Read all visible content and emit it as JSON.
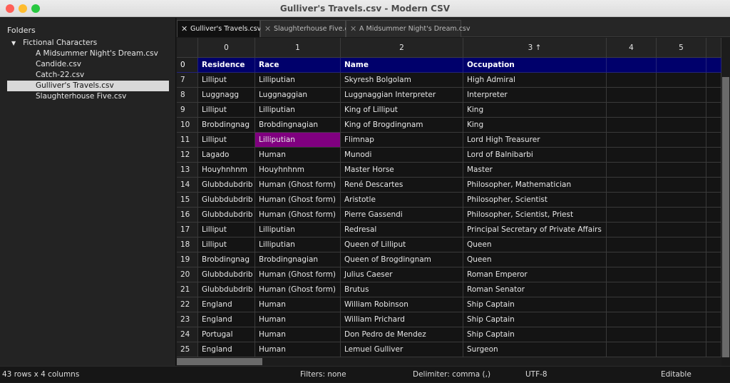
{
  "window": {
    "title": "Gulliver's Travels.csv - Modern CSV",
    "controls": {
      "close": "#ff5f57",
      "minimize": "#febc2e",
      "zoom": "#28c840"
    }
  },
  "sidebar": {
    "header": "Folders",
    "folder": "Fictional Characters",
    "files": [
      "A Midsummer Night's Dream.csv",
      "Candide.csv",
      "Catch-22.csv",
      "Gulliver's Travels.csv",
      "Slaughterhouse Five.csv"
    ],
    "selected_index": 3
  },
  "tabs": [
    {
      "label": "Gulliver's Travels.csv",
      "active": true
    },
    {
      "label": "Slaughterhouse Five.csv"
    },
    {
      "label": "A Midsummer Night's Dream.csv"
    }
  ],
  "grid": {
    "column_headers": [
      "0",
      "1",
      "2",
      "3 ↑",
      "4",
      "5",
      ""
    ],
    "header_row": {
      "num": "0",
      "cells": [
        "Residence",
        "Race",
        "Name",
        "Occupation"
      ]
    },
    "highlight_color": "#800080",
    "header_color": "#00006b",
    "rows": [
      {
        "num": "7",
        "cells": [
          "Lilliput",
          "Lilliputian",
          "Skyresh Bolgolam",
          "High Admiral"
        ]
      },
      {
        "num": "8",
        "cells": [
          "Luggnagg",
          "Luggnaggian",
          "Luggnaggian Interpreter",
          "Interpreter"
        ]
      },
      {
        "num": "9",
        "cells": [
          "Lilliput",
          "Lilliputian",
          "King of Lilliput",
          "King"
        ]
      },
      {
        "num": "10",
        "cells": [
          "Brobdingnag",
          "Brobdingnagian",
          "King of Brogdingnam",
          "King"
        ]
      },
      {
        "num": "11",
        "cells": [
          "Lilliput",
          "Lilliputian",
          "Flimnap",
          "Lord High Treasurer"
        ],
        "selected_col": 1
      },
      {
        "num": "12",
        "cells": [
          "Lagado",
          "Human",
          "Munodi",
          "Lord of Balnibarbi"
        ]
      },
      {
        "num": "13",
        "cells": [
          "Houyhnhnm",
          "Houyhnhnm",
          "Master Horse",
          "Master"
        ]
      },
      {
        "num": "14",
        "cells": [
          "Glubbdubdrib",
          "Human (Ghost form)",
          "René Descartes",
          "Philosopher, Mathematician"
        ]
      },
      {
        "num": "15",
        "cells": [
          "Glubbdubdrib",
          "Human (Ghost form)",
          "Aristotle",
          "Philosopher, Scientist"
        ]
      },
      {
        "num": "16",
        "cells": [
          "Glubbdubdrib",
          "Human (Ghost form)",
          "Pierre Gassendi",
          "Philosopher, Scientist, Priest"
        ]
      },
      {
        "num": "17",
        "cells": [
          "Lilliput",
          "Lilliputian",
          "Redresal",
          "Principal Secretary of Private Affairs"
        ]
      },
      {
        "num": "18",
        "cells": [
          "Lilliput",
          "Lilliputian",
          "Queen of Lilliput",
          "Queen"
        ]
      },
      {
        "num": "19",
        "cells": [
          "Brobdingnag",
          "Brobdingnagian",
          "Queen of Brogdingnam",
          "Queen"
        ]
      },
      {
        "num": "20",
        "cells": [
          "Glubbdubdrib",
          "Human (Ghost form)",
          "Julius Caeser",
          "Roman Emperor"
        ]
      },
      {
        "num": "21",
        "cells": [
          "Glubbdubdrib",
          "Human (Ghost form)",
          "Brutus",
          "Roman Senator"
        ]
      },
      {
        "num": "22",
        "cells": [
          "England",
          "Human",
          "William Robinson",
          "Ship Captain"
        ]
      },
      {
        "num": "23",
        "cells": [
          "England",
          "Human",
          "William Prichard",
          "Ship Captain"
        ]
      },
      {
        "num": "24",
        "cells": [
          "Portugal",
          "Human",
          "Don Pedro de Mendez",
          "Ship Captain"
        ]
      },
      {
        "num": "25",
        "cells": [
          "England",
          "Human",
          "Lemuel Gulliver",
          "Surgeon"
        ]
      }
    ]
  },
  "status": {
    "size": "43 rows x 4 columns",
    "filters": "Filters: none",
    "delimiter": "Delimiter: comma (,)",
    "encoding": "UTF-8",
    "mode": "Editable"
  }
}
